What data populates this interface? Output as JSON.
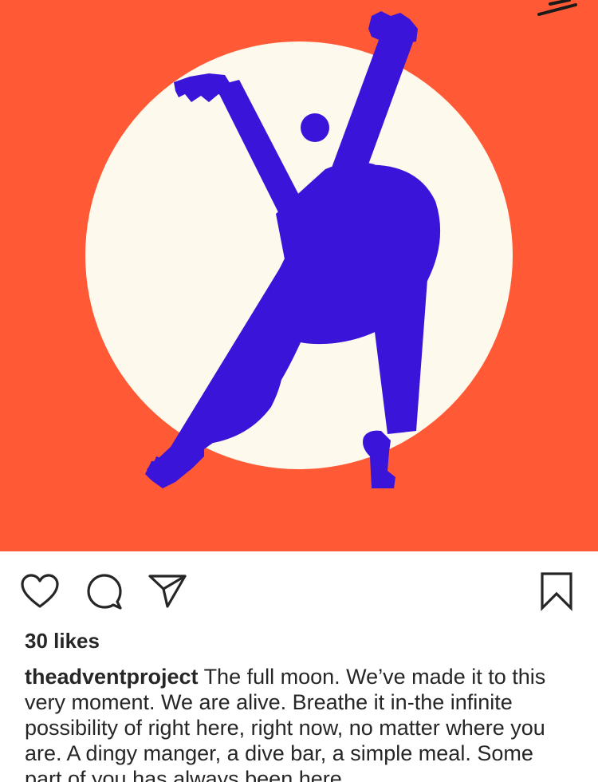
{
  "post": {
    "image": {
      "description_icon": "dancing-figure-illustration",
      "colors": {
        "background": "#FF5A35",
        "moon": "#FDF9EC",
        "figure": "#3A14D8",
        "corner_strokes": "#1A1A1A"
      }
    },
    "actions": {
      "like_icon": "heart-icon",
      "comment_icon": "comment-bubble-icon",
      "share_icon": "paper-plane-icon",
      "save_icon": "bookmark-icon"
    },
    "likes_text": "30 likes",
    "caption": {
      "username": "theadventproject",
      "text": "The full moon. We’ve made it to this very moment. We are alive. Breathe it in-the infinite possibility of right here, right now, no matter where you are. A dingy manger, a dive bar, a simple meal. Some part of you has always been here."
    }
  }
}
